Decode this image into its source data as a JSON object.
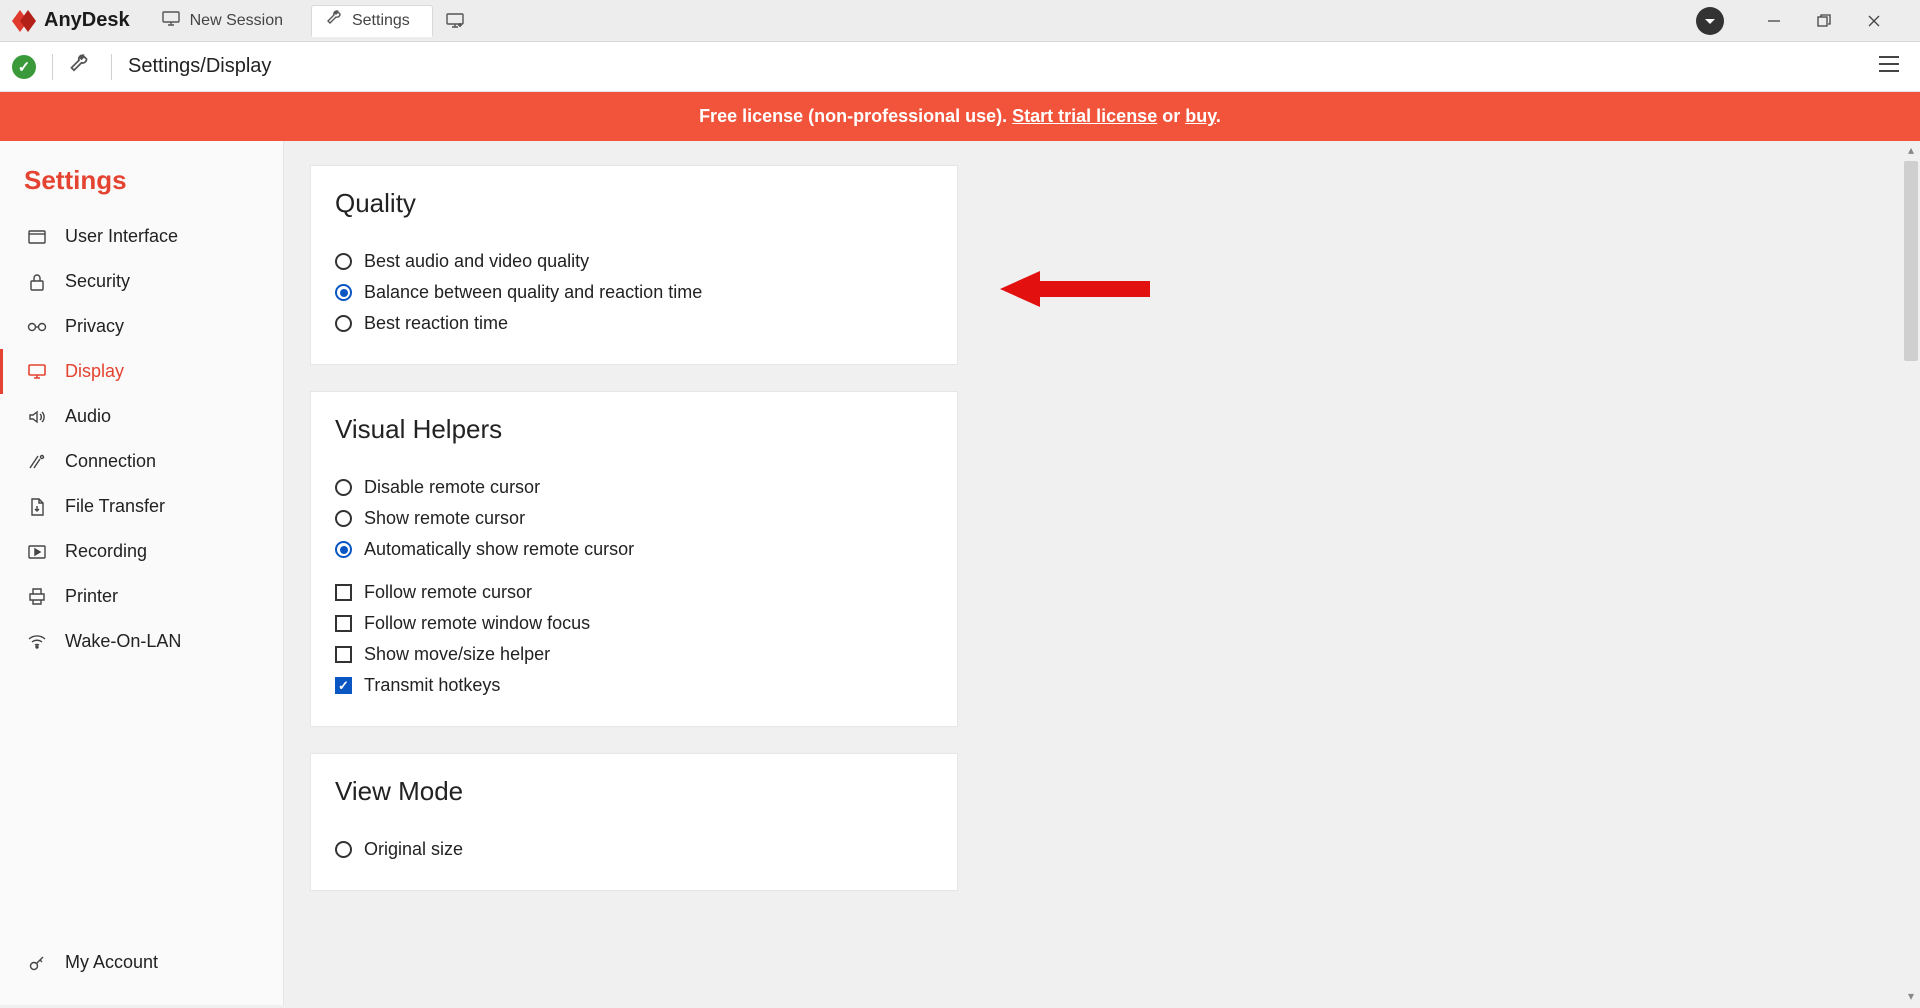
{
  "app": {
    "name": "AnyDesk"
  },
  "tabs": {
    "new_session": "New Session",
    "settings": "Settings"
  },
  "toolbar": {
    "breadcrumb": "Settings/Display"
  },
  "banner": {
    "prefix": "Free license (non-professional use). ",
    "link_trial": "Start trial license",
    "middle": " or ",
    "link_buy": "buy",
    "suffix": "."
  },
  "sidebar": {
    "title": "Settings",
    "items": [
      {
        "label": "User Interface"
      },
      {
        "label": "Security"
      },
      {
        "label": "Privacy"
      },
      {
        "label": "Display"
      },
      {
        "label": "Audio"
      },
      {
        "label": "Connection"
      },
      {
        "label": "File Transfer"
      },
      {
        "label": "Recording"
      },
      {
        "label": "Printer"
      },
      {
        "label": "Wake-On-LAN"
      }
    ],
    "account": "My Account"
  },
  "sections": {
    "quality": {
      "title": "Quality",
      "options": [
        "Best audio and video quality",
        "Balance between quality and reaction time",
        "Best reaction time"
      ],
      "selected": 1
    },
    "visual_helpers": {
      "title": "Visual Helpers",
      "cursor_options": [
        "Disable remote cursor",
        "Show remote cursor",
        "Automatically show remote cursor"
      ],
      "cursor_selected": 2,
      "checkboxes": [
        {
          "label": "Follow remote cursor",
          "checked": false
        },
        {
          "label": "Follow remote window focus",
          "checked": false
        },
        {
          "label": "Show move/size helper",
          "checked": false
        },
        {
          "label": "Transmit hotkeys",
          "checked": true
        }
      ]
    },
    "view_mode": {
      "title": "View Mode",
      "options": [
        "Original size"
      ],
      "selected": -1
    }
  }
}
